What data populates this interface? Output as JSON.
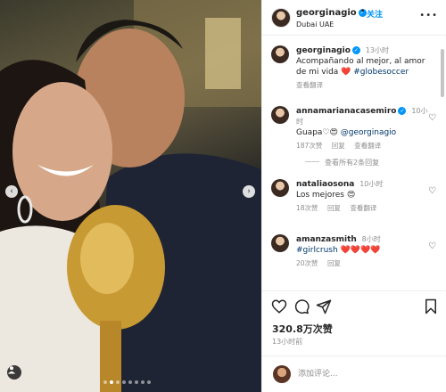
{
  "post": {
    "username": "georginagio",
    "follow_label": "关注",
    "separator": "•",
    "location": "Dubai UAE",
    "more": "•••"
  },
  "comments": [
    {
      "username": "georginagio",
      "time": "13小时",
      "text": "Acompañando al mejor, al amor de mi vida ❤️ ",
      "hashtag": "#globesoccer",
      "translate": "查看翻译"
    },
    {
      "username": "annamarianacasemiro",
      "time": "10小时",
      "text": "Guapa♡😍 ",
      "mention": "@georginagio",
      "likes": "187次赞",
      "reply": "回复",
      "translate": "查看翻译",
      "view_replies": "查看所有2条回复"
    },
    {
      "username": "nataliaosona",
      "time": "10小时",
      "text": "Los mejores 😍",
      "likes": "18次赞",
      "reply": "回复",
      "translate": "查看翻译"
    },
    {
      "username": "amanzasmith",
      "time": "8小时",
      "hashtag": "#girlcrush",
      "text": " ❤️❤️❤️❤️",
      "likes": "20次赞",
      "reply": "回复"
    }
  ],
  "actions": {
    "likes": "320.8万次赞",
    "time": "13小时前"
  },
  "add_comment": {
    "placeholder": "添加评论..."
  },
  "colors": {
    "accent": "#0095f6",
    "secondary_text": "#8e8e8e",
    "link": "#00376b"
  },
  "icons": [
    "chevron-left-icon",
    "chevron-right-icon",
    "tag-user-icon",
    "verified-icon",
    "heart-icon",
    "comment-icon",
    "share-icon",
    "bookmark-icon"
  ],
  "carousel": {
    "total": 8,
    "active": 2
  }
}
